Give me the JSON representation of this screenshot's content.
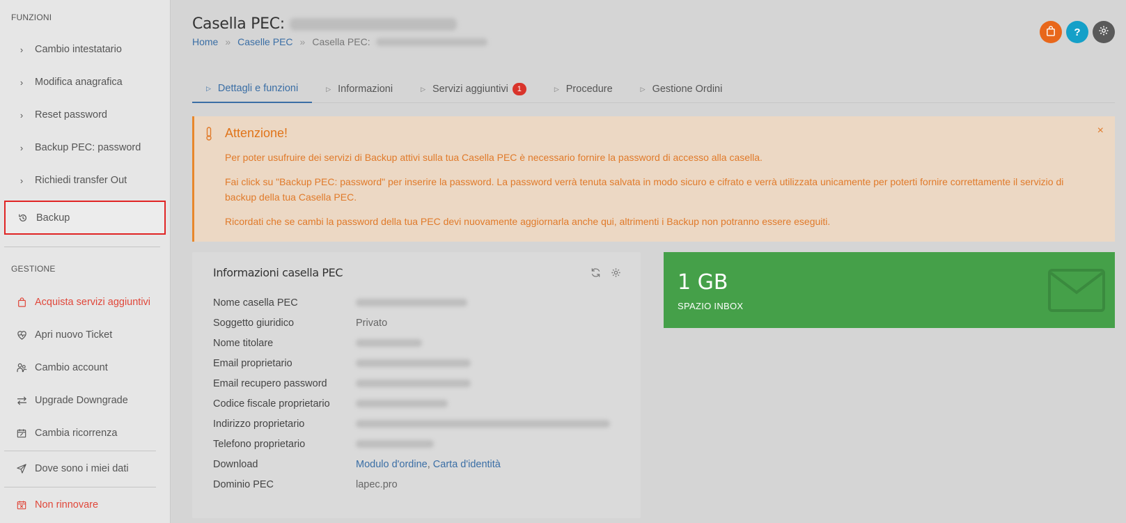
{
  "sidebar": {
    "section_functions": "FUNZIONI",
    "functions": [
      {
        "label": "Cambio intestatario",
        "icon": "chevron-right-icon"
      },
      {
        "label": "Modifica anagrafica",
        "icon": "chevron-right-icon"
      },
      {
        "label": "Reset password",
        "icon": "chevron-right-icon"
      },
      {
        "label": "Backup PEC: password",
        "icon": "chevron-right-icon"
      },
      {
        "label": "Richiedi transfer Out",
        "icon": "chevron-right-icon"
      },
      {
        "label": "Backup",
        "icon": "history-icon",
        "selected": true
      }
    ],
    "section_management": "GESTIONE",
    "management": [
      {
        "label": "Acquista servizi aggiuntivi",
        "icon": "shopping-bag-icon",
        "color": "#e0473a"
      },
      {
        "label": "Apri nuovo Ticket",
        "icon": "heart-pulse-icon"
      },
      {
        "label": "Cambio account",
        "icon": "users-icon"
      },
      {
        "label": "Upgrade Downgrade",
        "icon": "swap-arrows-icon"
      },
      {
        "label": "Cambia ricorrenza",
        "icon": "calendar-edit-icon"
      }
    ],
    "extra": [
      {
        "label": "Dove sono i miei dati",
        "icon": "send-icon"
      },
      {
        "label": "Non rinnovare",
        "icon": "calendar-x-icon",
        "color": "#e0473a"
      }
    ]
  },
  "header": {
    "title_prefix": "Casella PEC:",
    "breadcrumb": {
      "home": "Home",
      "sep1": "»",
      "caselle": "Caselle PEC",
      "sep2": "»",
      "current_prefix": "Casella PEC:"
    },
    "icons": {
      "cart_color": "#e8671b",
      "help_color": "#15a0c8",
      "settings_color": "#5a5a5a",
      "help_glyph": "?"
    }
  },
  "tabs": [
    {
      "label": "Dettagli e funzioni",
      "active": true
    },
    {
      "label": "Informazioni"
    },
    {
      "label": "Servizi aggiuntivi",
      "badge": "1"
    },
    {
      "label": "Procedure"
    },
    {
      "label": "Gestione Ordini"
    }
  ],
  "alert": {
    "title": "Attenzione!",
    "close": "×",
    "p1": "Per poter usufruire dei servizi di Backup attivi sulla tua Casella PEC è necessario fornire la password di accesso alla casella.",
    "p2": "Fai click su \"Backup PEC: password\" per inserire la password. La password verrà tenuta salvata in modo sicuro e cifrato e verrà utilizzata unicamente per poterti fornire correttamente il servizio di backup della tua Casella PEC.",
    "p3": "Ricordati che se cambi la password della tua PEC devi nuovamente aggiornarla anche qui, altrimenti i Backup non potranno essere eseguiti."
  },
  "info_card": {
    "title": "Informazioni casella PEC",
    "rows": [
      {
        "label": "Nome casella PEC",
        "value": ""
      },
      {
        "label": "Soggetto giuridico",
        "value": "Privato"
      },
      {
        "label": "Nome titolare",
        "value": ""
      },
      {
        "label": "Email proprietario",
        "value": ""
      },
      {
        "label": "Email recupero password",
        "value": ""
      },
      {
        "label": "Codice fiscale proprietario",
        "value": ""
      },
      {
        "label": "Indirizzo proprietario",
        "value": ""
      },
      {
        "label": "Telefono proprietario",
        "value": ""
      },
      {
        "label": "Download",
        "link1": "Modulo d'ordine",
        "link_sep": ",",
        "link2": "Carta d'identità"
      },
      {
        "label": "Dominio PEC",
        "value": "lapec.pro"
      }
    ]
  },
  "inbox": {
    "size": "1 GB",
    "label": "SPAZIO INBOX",
    "color": "#45a049"
  }
}
